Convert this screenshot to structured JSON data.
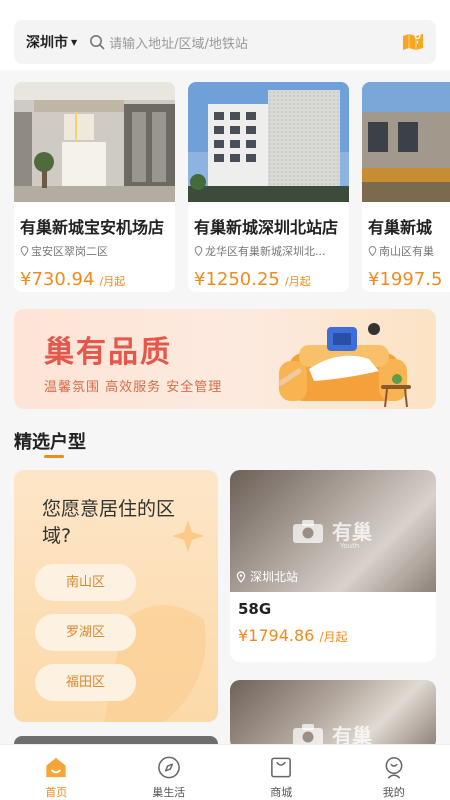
{
  "search": {
    "city": "深圳市",
    "placeholder": "请输入地址/区域/地铁站"
  },
  "stores": [
    {
      "name": "有巢新城宝安机场店",
      "address": "宝安区翠岗二区",
      "price": "¥730.94",
      "unit": "/月起"
    },
    {
      "name": "有巢新城深圳北站店",
      "address": "龙华区有巢新城深圳北...",
      "price": "¥1250.25",
      "unit": "/月起"
    },
    {
      "name": "有巢新城",
      "address": "南山区有巢",
      "price": "¥1997.5",
      "unit": ""
    }
  ],
  "banner": {
    "title": "巢有品质",
    "subtitle": "温馨氛围  高效服务  安全管理"
  },
  "section": {
    "title": "精选户型"
  },
  "region_card": {
    "question": "您愿意居住的区域?",
    "options": [
      "南山区",
      "罗湖区",
      "福田区"
    ]
  },
  "rooms": [
    {
      "location": "深圳北站",
      "name": "58G",
      "price": "¥1794.86",
      "unit": "/月起",
      "watermark": "有巢",
      "watermark_sub": "Youth"
    },
    {
      "watermark": "有巢"
    }
  ],
  "tabs": [
    {
      "label": "首页",
      "icon": "home-icon",
      "active": true
    },
    {
      "label": "巢生活",
      "icon": "compass-icon",
      "active": false
    },
    {
      "label": "商城",
      "icon": "shopping-bag-icon",
      "active": false
    },
    {
      "label": "我的",
      "icon": "profile-icon",
      "active": false
    }
  ],
  "colors": {
    "accent": "#f28a1c",
    "banner_title": "#e6564a",
    "region_button_text": "#d8882e"
  }
}
